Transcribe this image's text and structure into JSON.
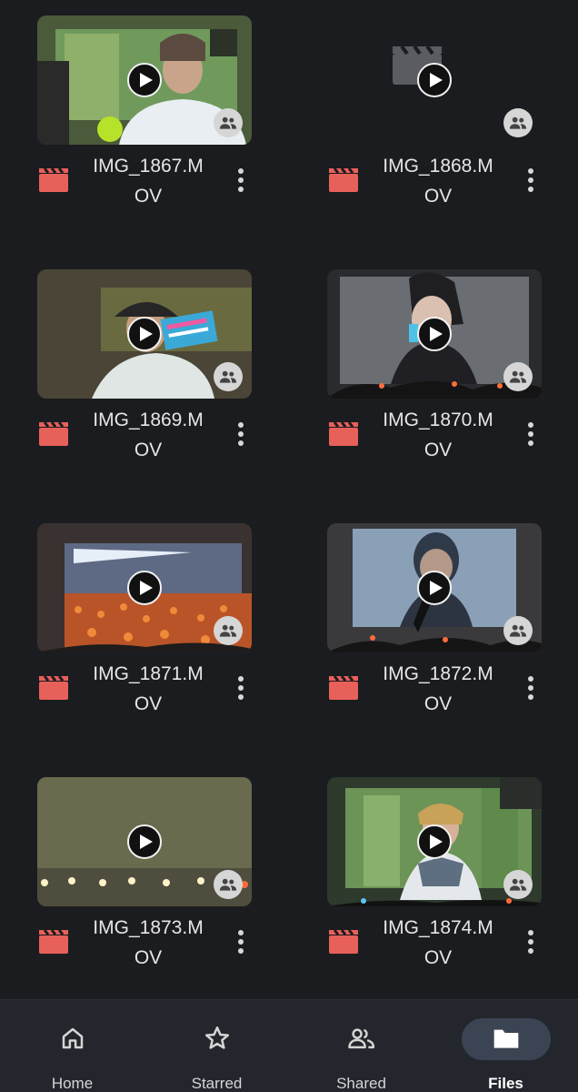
{
  "files": [
    {
      "name": "IMG_1867.MOV",
      "line1": "IMG_1867.M",
      "line2": "OV",
      "thumb": "stage-green",
      "has_thumbnail": true
    },
    {
      "name": "IMG_1868.MOV",
      "line1": "IMG_1868.M",
      "line2": "OV",
      "thumb": "none",
      "has_thumbnail": false
    },
    {
      "name": "IMG_1869.MOV",
      "line1": "IMG_1869.M",
      "line2": "OV",
      "thumb": "stage-sign",
      "has_thumbnail": true
    },
    {
      "name": "IMG_1870.MOV",
      "line1": "IMG_1870.M",
      "line2": "OV",
      "thumb": "screen-closeup",
      "has_thumbnail": true
    },
    {
      "name": "IMG_1871.MOV",
      "line1": "IMG_1871.M",
      "line2": "OV",
      "thumb": "crowd-orange",
      "has_thumbnail": true
    },
    {
      "name": "IMG_1872.MOV",
      "line1": "IMG_1872.M",
      "line2": "OV",
      "thumb": "screen-blue",
      "has_thumbnail": true
    },
    {
      "name": "IMG_1873.MOV",
      "line1": "IMG_1873.M",
      "line2": "OV",
      "thumb": "stage-lights",
      "has_thumbnail": true
    },
    {
      "name": "IMG_1874.MOV",
      "line1": "IMG_1874.M",
      "line2": "OV",
      "thumb": "stage-green-2",
      "has_thumbnail": true
    }
  ],
  "icons": {
    "play": "play-icon",
    "shared": "shared-people-icon",
    "type": "video-file-icon",
    "more": "more-vert-icon"
  },
  "nav": {
    "items": [
      {
        "label": "Home",
        "icon": "home-icon",
        "active": false
      },
      {
        "label": "Starred",
        "icon": "star-icon",
        "active": false
      },
      {
        "label": "Shared",
        "icon": "shared-icon",
        "active": false
      },
      {
        "label": "Files",
        "icon": "folder-icon",
        "active": true
      }
    ]
  },
  "colors": {
    "background": "#1b1c1f",
    "video_icon": "#e8605a",
    "nav_background": "#23262c",
    "active_pill": "#3a4452"
  }
}
